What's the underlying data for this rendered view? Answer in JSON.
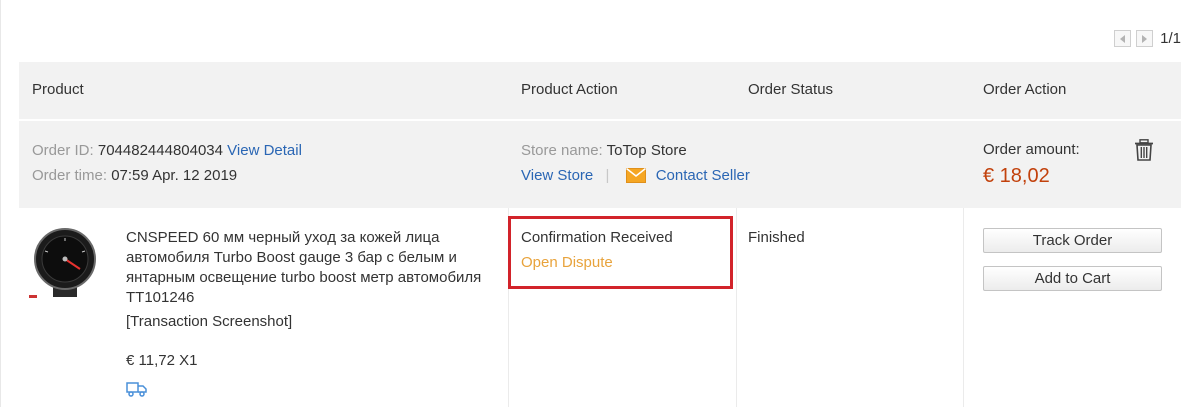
{
  "pagination": {
    "text": "1/1"
  },
  "table_header": {
    "product": "Product",
    "product_action": "Product Action",
    "order_status": "Order Status",
    "order_action": "Order Action"
  },
  "order": {
    "id_label": "Order ID:",
    "id_value": "704482444804034",
    "view_detail": "View Detail",
    "time_label": "Order time:",
    "time_value": "07:59 Apr. 12 2019",
    "store_label": "Store name:",
    "store_value": "ToTop Store",
    "view_store": "View Store",
    "separator": "|",
    "contact_seller": "Contact Seller",
    "amount_label": "Order amount:",
    "amount_value": "€ 18,02"
  },
  "item": {
    "title": "CNSPEED 60 мм черный уход за кожей лица автомобиля Turbo Boost gauge 3 бар с белым и янтарным освещение turbo boost метр автомобиля TT101246",
    "transaction_screenshot": "[Transaction Screenshot]",
    "price": "€ 11,72 X1",
    "product_status": "Confirmation Received",
    "open_dispute": "Open Dispute",
    "order_status": "Finished",
    "track_order": "Track Order",
    "add_to_cart": "Add to Cart"
  },
  "colors": {
    "link": "#2a66b4",
    "dispute": "#e8a33c",
    "amount": "#c2410c",
    "highlight_border": "#d2232a",
    "header_bg": "#f2f2f2"
  },
  "icons": [
    "chevron-left-icon",
    "chevron-right-icon",
    "mail-icon",
    "trash-icon",
    "truck-icon",
    "boost-gauge-thumbnail"
  ]
}
